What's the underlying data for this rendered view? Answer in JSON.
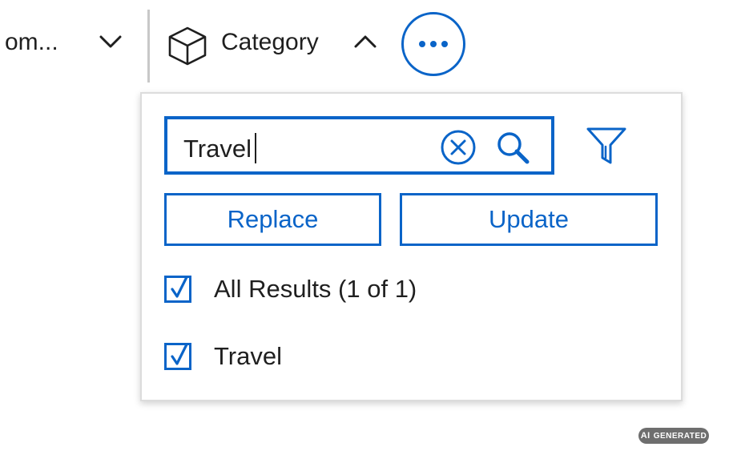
{
  "toolbar": {
    "prev_filter_label": "om...",
    "prev_chevron_icon": "chevron-down-icon",
    "category_icon": "cube-icon",
    "category_label": "Category",
    "category_chevron_icon": "chevron-up-icon",
    "more_icon": "more-horizontal-icon"
  },
  "panel": {
    "search": {
      "value": "Travel",
      "clear_icon": "clear-circle-icon",
      "search_icon": "search-icon"
    },
    "filter_icon": "filter-icon",
    "buttons": {
      "replace": "Replace",
      "update": "Update"
    },
    "options": [
      {
        "label": "All Results (1 of 1)",
        "checked": true
      },
      {
        "label": "Travel",
        "checked": true
      }
    ]
  },
  "badge": {
    "ai": "AI",
    "text": "GENERATED"
  },
  "colors": {
    "accent": "#0a64c8",
    "text": "#1f1f1f",
    "divider": "#c8c8c8",
    "panel_border": "#dcdcdc"
  }
}
